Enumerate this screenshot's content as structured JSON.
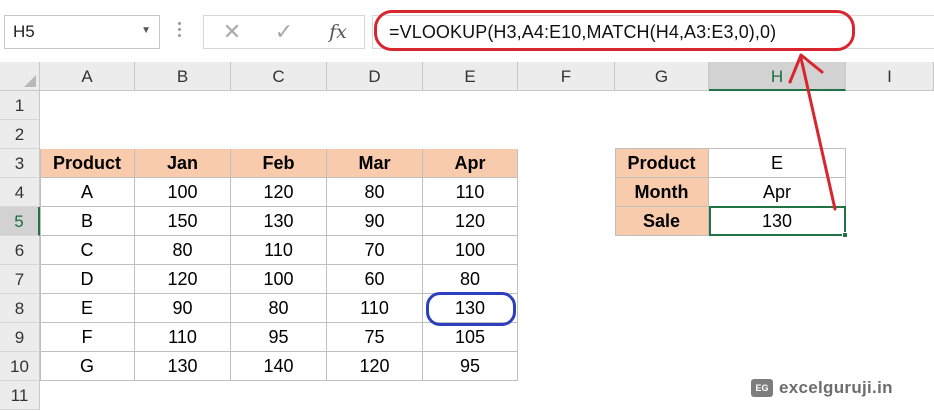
{
  "name_box": {
    "value": "H5"
  },
  "formula_bar": {
    "cancel_icon": "✕",
    "enter_icon": "✓",
    "fx_label": "fx",
    "formula": "=VLOOKUP(H3,A4:E10,MATCH(H4,A3:E3,0),0)"
  },
  "columns": [
    "A",
    "B",
    "C",
    "D",
    "E",
    "F",
    "G",
    "H",
    "I"
  ],
  "rows": [
    "1",
    "2",
    "3",
    "4",
    "5",
    "6",
    "7",
    "8",
    "9",
    "10",
    "11"
  ],
  "selection": {
    "column": "H",
    "row": "5"
  },
  "table": {
    "headers": [
      "Product",
      "Jan",
      "Feb",
      "Mar",
      "Apr"
    ],
    "rows": [
      [
        "A",
        "100",
        "120",
        "80",
        "110"
      ],
      [
        "B",
        "150",
        "130",
        "90",
        "120"
      ],
      [
        "C",
        "80",
        "110",
        "70",
        "100"
      ],
      [
        "D",
        "120",
        "100",
        "60",
        "80"
      ],
      [
        "E",
        "90",
        "80",
        "110",
        "130"
      ],
      [
        "F",
        "110",
        "95",
        "75",
        "105"
      ],
      [
        "G",
        "130",
        "140",
        "120",
        "95"
      ]
    ]
  },
  "lookup": {
    "rows": [
      {
        "label": "Product",
        "value": "E"
      },
      {
        "label": "Month",
        "value": "Apr"
      },
      {
        "label": "Sale",
        "value": "130"
      }
    ]
  },
  "colors": {
    "header_fill": "#f8cbad",
    "selection_green": "#217346",
    "formula_highlight": "#d8262e",
    "result_highlight": "#2b3fbf"
  },
  "watermark": {
    "logo": "EG",
    "text": "excelguruji.in"
  }
}
